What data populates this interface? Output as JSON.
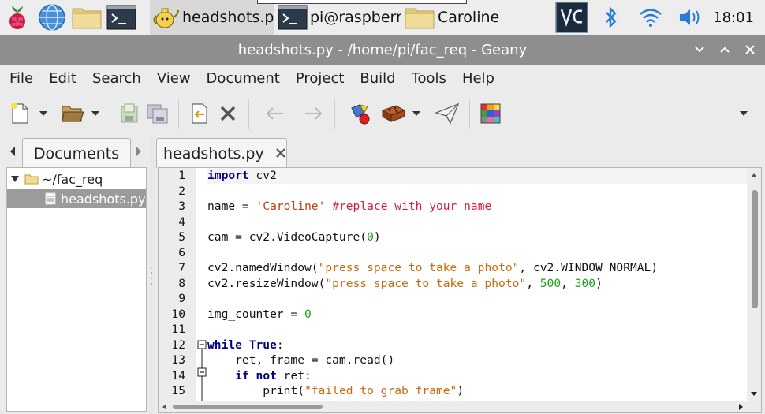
{
  "taskbar": {
    "tasks": [
      {
        "label": "headshots.p…",
        "active": true
      },
      {
        "label": "pi@raspberr…",
        "active": false
      },
      {
        "label": "Caroline",
        "active": false
      }
    ],
    "clock": "18:01"
  },
  "window": {
    "title": "headshots.py - /home/pi/fac_req - Geany"
  },
  "menu": [
    "File",
    "Edit",
    "Search",
    "View",
    "Document",
    "Project",
    "Build",
    "Tools",
    "Help"
  ],
  "sidebar": {
    "tab_label": "Documents",
    "tree": {
      "folder": "~/fac_req",
      "file": "headshots.py"
    }
  },
  "editor": {
    "tab_label": "headshots.py",
    "current_line": 1,
    "line_numbers": [
      "1",
      "2",
      "3",
      "4",
      "5",
      "6",
      "7",
      "8",
      "9",
      "10",
      "11",
      "12",
      "13",
      "14",
      "15"
    ],
    "code": {
      "l1_kw": "import",
      "l1_rest": " cv2",
      "l3_a": "name = ",
      "l3_str": "'Caroline'",
      "l3_sp": " ",
      "l3_cmt": "#replace with your name",
      "l5_a": "cam = cv2.VideoCapture(",
      "l5_num": "0",
      "l5_b": ")",
      "l7_a": "cv2.namedWindow(",
      "l7_str": "\"press space to take a photo\"",
      "l7_b": ", cv2.WINDOW_NORMAL)",
      "l8_a": "cv2.resizeWindow(",
      "l8_str": "\"press space to take a photo\"",
      "l8_b": ", ",
      "l8_n1": "500",
      "l8_c": ", ",
      "l8_n2": "300",
      "l8_d": ")",
      "l10_a": "img_counter = ",
      "l10_num": "0",
      "l12_kw1": "while",
      "l12_sp": " ",
      "l12_kw2": "True",
      "l12_b": ":",
      "l13_a": "    ret, frame = cam.read()",
      "l14_ind": "    ",
      "l14_kw1": "if",
      "l14_sp": " ",
      "l14_kw2": "not",
      "l14_b": " ret:",
      "l15_ind": "        ",
      "l15_kw": "print",
      "l15_a": "(",
      "l15_str": "\"failed to grab frame\"",
      "l15_b": ")"
    }
  },
  "colors": {
    "keyword": "#00007f",
    "string": "#c96b0c",
    "comment": "#d4203a",
    "number": "#20a020",
    "titlebar": "#8e8e8e"
  },
  "icons": {
    "taskbar_launchers": [
      "raspberry-icon",
      "globe-icon",
      "folder-icon",
      "terminal-icon"
    ],
    "tray": [
      "vnc-icon",
      "bluetooth-icon",
      "wifi-icon",
      "volume-icon"
    ],
    "toolbar": [
      "new-file-icon",
      "open-file-icon",
      "save-icon",
      "save-all-icon",
      "revert-icon",
      "close-file-icon",
      "back-arrow-icon",
      "forward-arrow-icon",
      "compile-icon",
      "build-icon",
      "execute-icon",
      "color-chooser-icon"
    ]
  }
}
